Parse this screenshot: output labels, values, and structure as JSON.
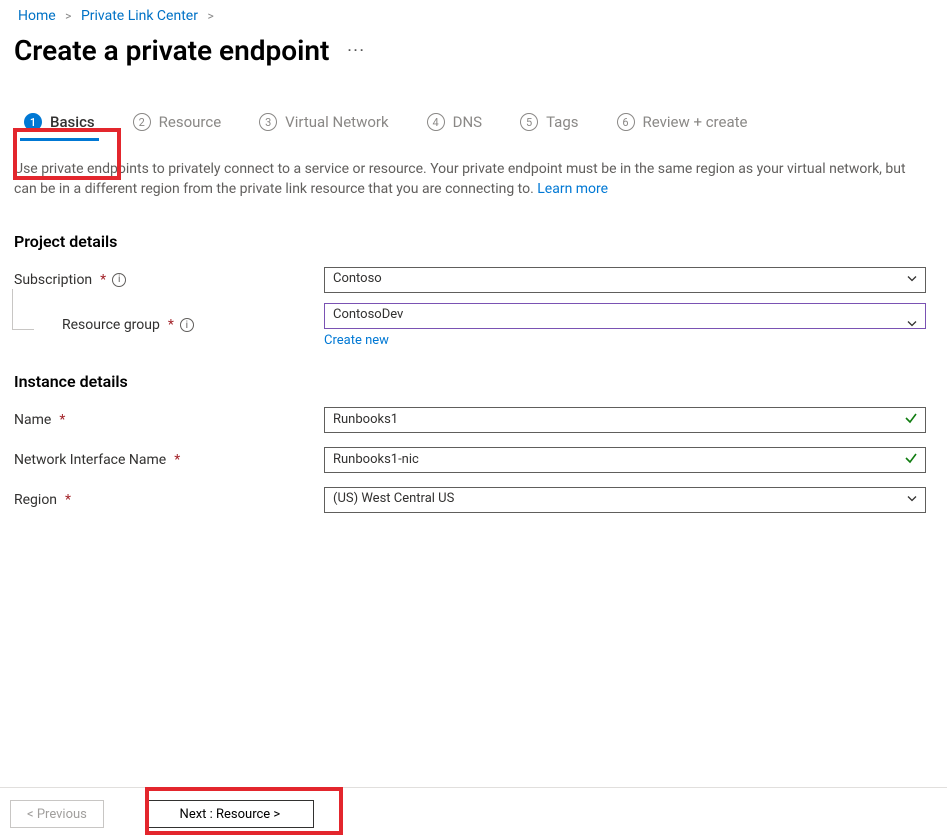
{
  "breadcrumb": {
    "items": [
      "Home",
      "Private Link Center"
    ]
  },
  "page": {
    "title": "Create a private endpoint",
    "intro_text": "Use private endpoints to privately connect to a service or resource. Your private endpoint must be in the same region as your virtual network, but can be in a different region from the private link resource that you are connecting to.  ",
    "learn_more": "Learn more"
  },
  "tabs": [
    {
      "num": "1",
      "label": "Basics",
      "active": true
    },
    {
      "num": "2",
      "label": "Resource",
      "active": false
    },
    {
      "num": "3",
      "label": "Virtual Network",
      "active": false
    },
    {
      "num": "4",
      "label": "DNS",
      "active": false
    },
    {
      "num": "5",
      "label": "Tags",
      "active": false
    },
    {
      "num": "6",
      "label": "Review + create",
      "active": false
    }
  ],
  "sections": {
    "project": {
      "title": "Project details",
      "subscription": {
        "label": "Subscription",
        "value": "Contoso"
      },
      "resource_group": {
        "label": "Resource group",
        "value": "ContosoDev",
        "create_new": "Create new"
      }
    },
    "instance": {
      "title": "Instance details",
      "name": {
        "label": "Name",
        "value": "Runbooks1"
      },
      "nic": {
        "label": "Network Interface Name",
        "value": "Runbooks1-nic"
      },
      "region": {
        "label": "Region",
        "value": "(US) West Central US"
      }
    }
  },
  "footer": {
    "previous": "< Previous",
    "next": "Next : Resource >"
  }
}
